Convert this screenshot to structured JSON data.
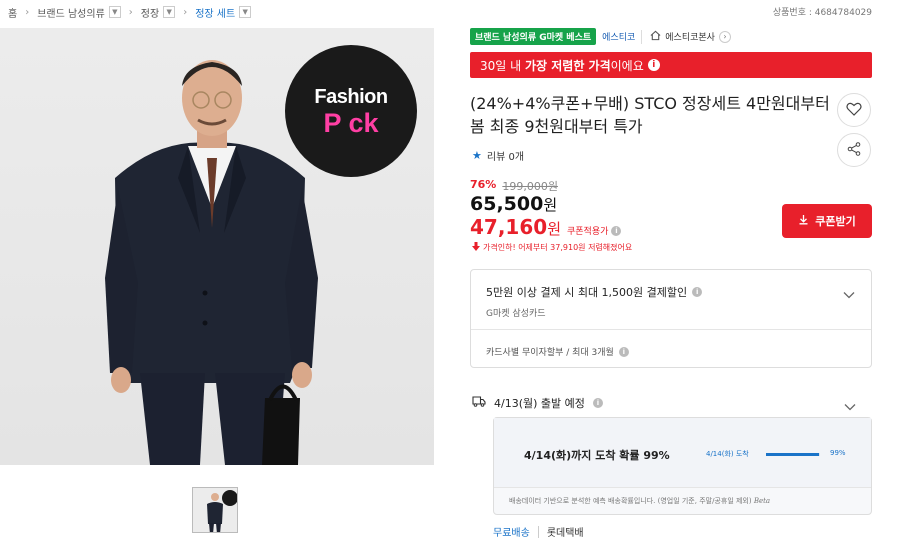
{
  "breadcrumb": [
    {
      "label": "홈",
      "dropdown": false
    },
    {
      "label": "브랜드 남성의류",
      "dropdown": true
    },
    {
      "label": "정장",
      "dropdown": true
    },
    {
      "label": "정장 세트",
      "dropdown": true,
      "active": true
    }
  ],
  "product_no": "상품번호 : 4684784029",
  "badges": {
    "best": "브랜드 남성의류 G마켓 베스트",
    "seller": "에스티코",
    "shop": "에스티코본사"
  },
  "lowest_price_bar": {
    "prefix": "30일 내 ",
    "bold": "가장 저렴한 가격",
    "suffix": "이에요"
  },
  "title": "(24%+4%쿠폰+무배) STCO 정장세트 4만원대부터 봄 최종 9천원대부터 특가",
  "image_badge": {
    "line1": "Fashion",
    "line2": "P ck"
  },
  "review": "리뷰 0개",
  "price": {
    "discount_rate": "76%",
    "original": "199,000원",
    "sale": "65,500",
    "won": "원",
    "coupon_price": "47,160",
    "coupon_label": "쿠폰적용가",
    "drop_note": "가격인하! 어제부터 37,910원 저렴해졌어요"
  },
  "coupon_button": "쿠폰받기",
  "card_promo": {
    "title": "5만원 이상 결제 시 최대 1,500원 결제할인",
    "sub": "G마켓 삼성카드",
    "installment": "카드사별 무이자할부 / 최대 3개월"
  },
  "shipping": {
    "title": "4/13(월) 출발 예정",
    "probability": "4/14(화)까지 도착 확률 99%",
    "small_date": "4/14(화) 도착",
    "percent_label": "99%",
    "percent_value": 0.99,
    "note": "배송데이터 기반으로 분석한 예측 배송확률입니다. (영업일 기준, 주말/공휴일 제외)",
    "beta": "Beta",
    "free": "무료배송",
    "carrier": "롯데택배"
  },
  "colors": {
    "accent_red": "#e8202b",
    "accent_blue": "#1a73c8",
    "best_green": "#16a34a"
  }
}
